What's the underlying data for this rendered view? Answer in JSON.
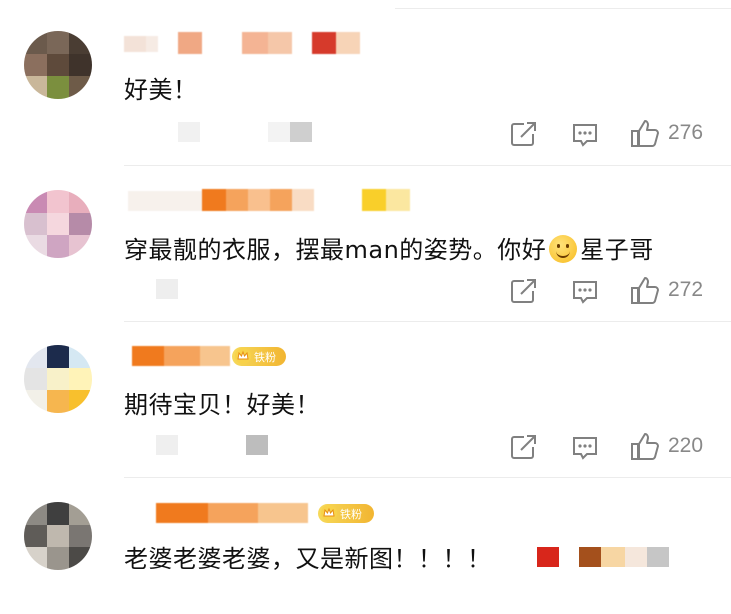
{
  "comments": [
    {
      "text": "好美！",
      "likes": "276",
      "avatar_colors": [
        "#6b5a4c",
        "#7a6758",
        "#4a3d33",
        "#8b6f5e",
        "#5e4a3b",
        "#3f332b",
        "#c9b79a",
        "#7b8f3e",
        "#6e5b48"
      ],
      "name_colors": [
        "#f0a884",
        "#f4b494",
        "#f5c7a9",
        "#d63a2b",
        "#f7d4b7"
      ]
    },
    {
      "text_before": "穿最靓的衣服，摆最man的姿势。你好",
      "text_after": "星子哥",
      "likes": "272",
      "avatar_colors": [
        "#c98ab3",
        "#f2c4cf",
        "#e8aebc",
        "#d8c0cf",
        "#f5d7de",
        "#b68ba8",
        "#eadbe3",
        "#cfa5c2",
        "#e7c3d1"
      ],
      "name_colors": [
        "#f07a1e",
        "#f5a35c",
        "#f9c08e",
        "#f9dcc4",
        "#f9cf2a"
      ]
    },
    {
      "text": "期待宝贝！好美！",
      "likes": "220",
      "badge": "铁粉",
      "avatar_colors": [
        "#e3e7ef",
        "#1c2b4c",
        "#d5e8f3",
        "#e4e4e4",
        "#f8f1c9",
        "#fff3b8",
        "#f2f0e8",
        "#f6b64f",
        "#f8c02d"
      ],
      "name_colors": [
        "#f07a1e",
        "#f5a35c",
        "#f7c58e"
      ]
    },
    {
      "text": "老婆老婆老婆，又是新图！！！！",
      "badge": "铁粉",
      "avatar_colors": [
        "#8d8a84",
        "#3f3f3f",
        "#a39e94",
        "#5f5c58",
        "#bfb8ae",
        "#7a7672",
        "#d7d2ca",
        "#9a958d",
        "#4c4a47"
      ],
      "name_colors": [
        "#f07a1e",
        "#f5a35c",
        "#f7c58e"
      ]
    }
  ]
}
